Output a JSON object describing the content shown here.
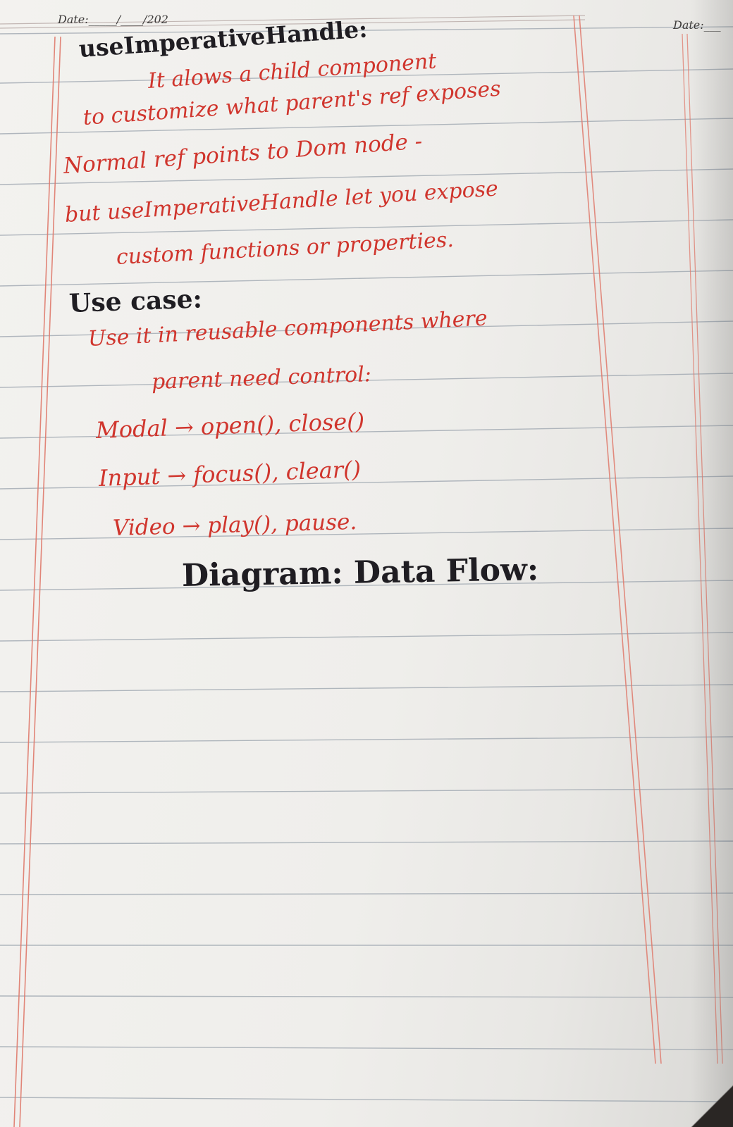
{
  "header": {
    "date_left": "Date:_____/____/202",
    "date_right": "Date:___"
  },
  "title": "useImperativeHandle:",
  "intro_lines": [
    "It alows a child component",
    "to customize what parent's ref exposes",
    "Normal ref points to Dom node -",
    "but useImperativeHandle let you expose",
    "custom functions or properties."
  ],
  "use_case": {
    "heading": "Use case:",
    "lines": [
      "Use it in reusable components where",
      "parent need control:"
    ],
    "examples": [
      "Modal → open(), close()",
      "Input → focus(), clear()",
      "Video → play(), pause."
    ]
  },
  "diagram_heading": "Diagram: Data Flow:",
  "colors": {
    "ink_red": "#d0352d",
    "ink_dark": "#1f1d22",
    "margin_line": "#e07a6c",
    "rule_line": "#9aa3ad"
  }
}
